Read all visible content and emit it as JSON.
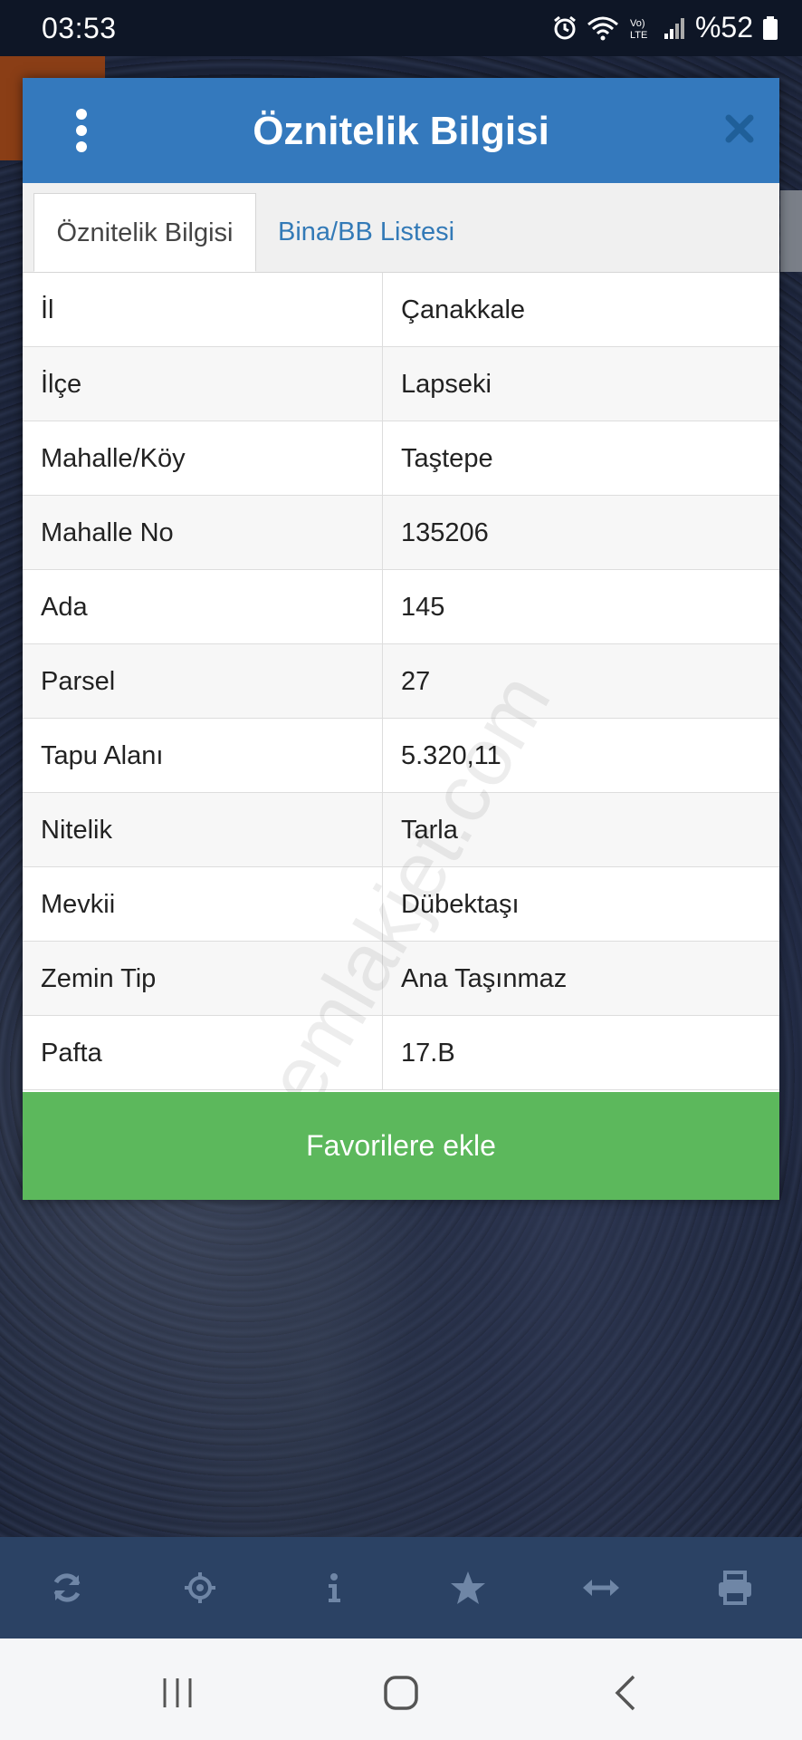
{
  "status_bar": {
    "time": "03:53",
    "battery": "%52",
    "icons": [
      "alarm-icon",
      "wifi-icon",
      "volte-icon",
      "signal-icon",
      "battery-icon"
    ]
  },
  "modal": {
    "title": "Öznitelik Bilgisi",
    "tabs": [
      {
        "label": "Öznitelik Bilgisi",
        "active": true
      },
      {
        "label": "Bina/BB Listesi",
        "active": false
      }
    ],
    "rows": [
      {
        "key": "İl",
        "value": "Çanakkale"
      },
      {
        "key": "İlçe",
        "value": "Lapseki"
      },
      {
        "key": "Mahalle/Köy",
        "value": "Taştepe"
      },
      {
        "key": "Mahalle No",
        "value": "135206"
      },
      {
        "key": "Ada",
        "value": "145"
      },
      {
        "key": "Parsel",
        "value": "27"
      },
      {
        "key": "Tapu Alanı",
        "value": "5.320,11"
      },
      {
        "key": "Nitelik",
        "value": "Tarla"
      },
      {
        "key": "Mevkii",
        "value": "Dübektaşı"
      },
      {
        "key": "Zemin Tip",
        "value": "Ana Taşınmaz"
      },
      {
        "key": "Pafta",
        "value": "17.B"
      }
    ],
    "favorite_label": "Favorilere ekle",
    "watermark": "emlakjet.com"
  },
  "toolbar": {
    "items": [
      "refresh-icon",
      "locate-icon",
      "info-icon",
      "star-icon",
      "measure-icon",
      "print-icon"
    ]
  },
  "colors": {
    "header": "#3479bd",
    "favorite": "#5cb85c",
    "toolbar": "#2b4264",
    "tab_link": "#337ab7"
  }
}
